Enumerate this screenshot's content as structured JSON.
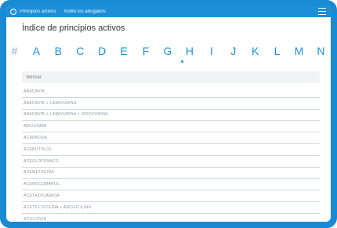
{
  "topbar": {
    "back_glyph": "‹",
    "tabs": [
      "Principios activos",
      "Sobre los abogados"
    ]
  },
  "page": {
    "title": "Índice de principios activos"
  },
  "alphabet": [
    "#",
    "A",
    "B",
    "C",
    "D",
    "E",
    "F",
    "G",
    "H",
    "I",
    "J",
    "K",
    "L",
    "M",
    "N"
  ],
  "selected_letter": "G",
  "search": {
    "placeholder": "Buscar"
  },
  "list": {
    "items": [
      "Abacavir",
      "Abacavir + lamivudina",
      "Abacavir + lamivudina + zidovudina",
      "Abciximab",
      "Acarbosa",
      "Acebutolol",
      "Aceclofenaco",
      "Acemetacina",
      "Acenocumarol",
      "Acetazolamida",
      "Acetilcisteína + amoxicilina",
      "Aciclovir"
    ]
  },
  "colors": {
    "frame": "#1a8ad4",
    "topbar": "#1c8fd8",
    "accent": "#1c8fd8"
  },
  "icons": {
    "back": "back-circle-icon",
    "menu": "menu-icon"
  }
}
